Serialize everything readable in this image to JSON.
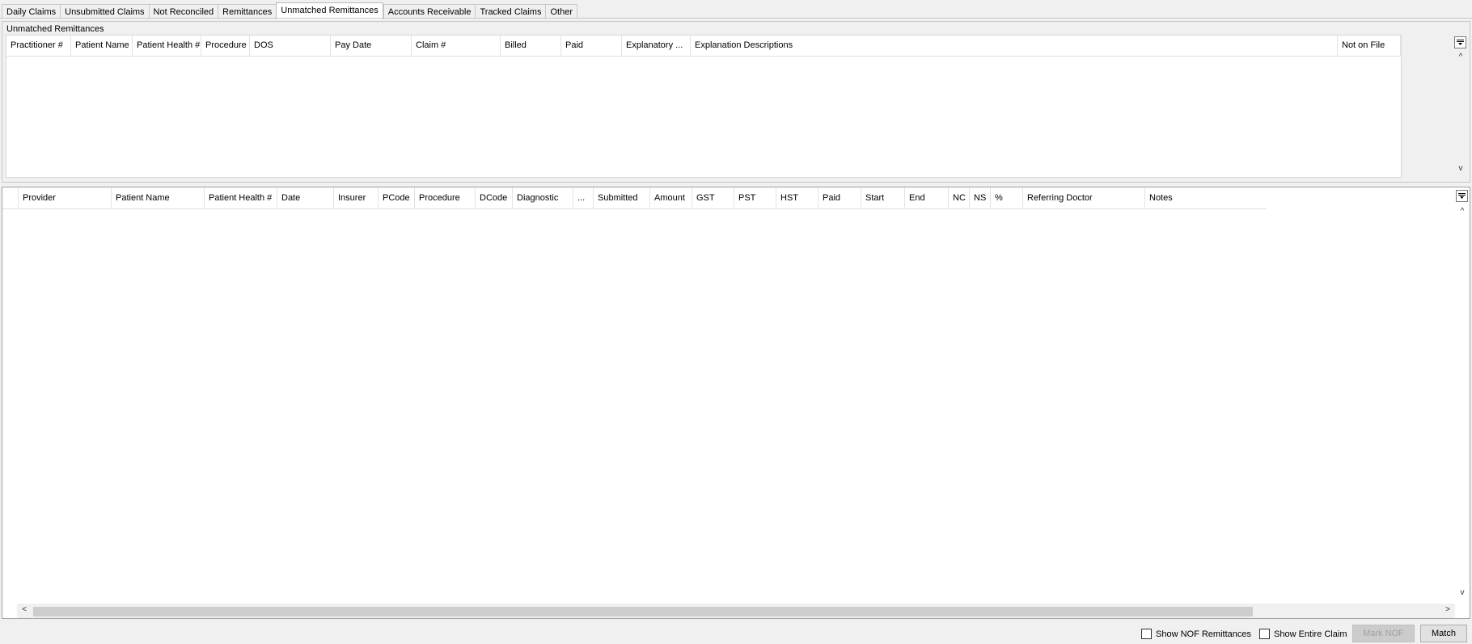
{
  "tabs": [
    {
      "label": "Daily Claims"
    },
    {
      "label": "Unsubmitted Claims"
    },
    {
      "label": "Not Reconciled"
    },
    {
      "label": "Remittances"
    },
    {
      "label": "Unmatched Remittances",
      "active": true
    },
    {
      "label": "Accounts Receivable"
    },
    {
      "label": "Tracked Claims"
    },
    {
      "label": "Other"
    }
  ],
  "unmatched": {
    "title": "Unmatched Remittances",
    "columns": [
      "Practitioner #",
      "Patient Name",
      "Patient Health #",
      "Procedure",
      "DOS",
      "Pay Date",
      "Claim #",
      "Billed",
      "Paid",
      "Explanatory ...",
      "Explanation Descriptions",
      "Not on File"
    ]
  },
  "claims": {
    "columns": [
      "Provider",
      "Patient Name",
      "Patient Health #",
      "Date",
      "Insurer",
      "PCode",
      "Procedure",
      "DCode",
      "Diagnostic",
      "...",
      "Submitted",
      "Amount",
      "GST",
      "PST",
      "HST",
      "Paid",
      "Start",
      "End",
      "NC",
      "NS",
      "%",
      "Referring Doctor",
      "Notes"
    ]
  },
  "footer": {
    "show_nof": "Show NOF Remittances",
    "show_entire": "Show Entire Claim",
    "mark_nof": "Mark NOF",
    "match": "Match"
  }
}
